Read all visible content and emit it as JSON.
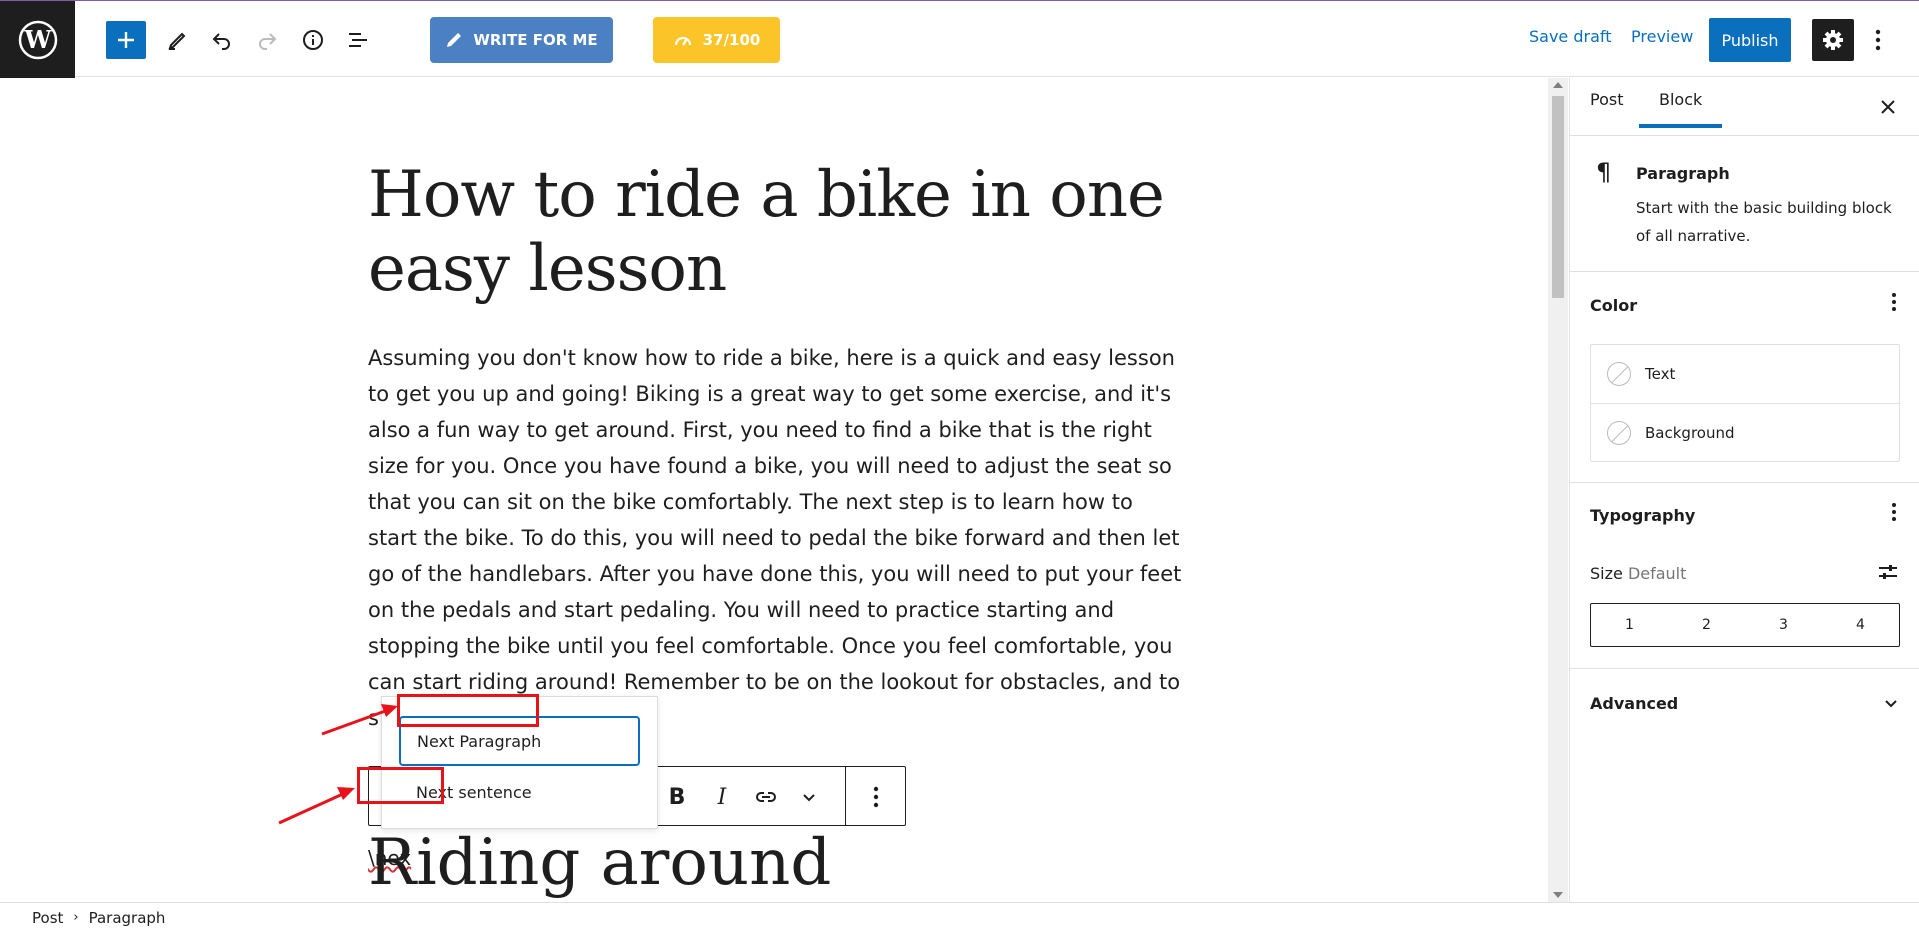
{
  "topbar": {
    "write_label": "WRITE FOR ME",
    "score_label": "37/100",
    "save_draft": "Save draft",
    "preview": "Preview",
    "publish": "Publish"
  },
  "editor": {
    "title": "How to ride a bike in one easy lesson",
    "paragraph": "Assuming you don't know how to ride a bike, here is a quick and easy lesson to get you up and going! Biking is a great way to get some exercise, and it's also a fun way to get around. First, you need to find a bike that is the right size for you. Once you have found a bike, you will need to adjust the seat so that you can sit on the bike comfortably. The next step is to learn how to start the bike. To do this, you will need to pedal the bike forward and then let go of the handlebars. After you have done this, you will need to put your feet on the pedals and start pedaling. You will need to practice starting and stopping the bike until you feel comfortable. Once you feel comfortable, you can start riding around! Remember to be on the lookout for obstacles, and to signal when you are",
    "slash_text": "\\nex",
    "heading2": "Riding around"
  },
  "popover": {
    "items": [
      "Next Paragraph",
      "Next sentence"
    ]
  },
  "sidebar": {
    "tabs": [
      "Post",
      "Block"
    ],
    "block_name": "Paragraph",
    "block_desc": "Start with the basic building block of all narrative.",
    "color_heading": "Color",
    "color_items": [
      "Text",
      "Background"
    ],
    "typography_heading": "Typography",
    "size_label": "Size",
    "size_value": "Default",
    "size_options": [
      "1",
      "2",
      "3",
      "4"
    ],
    "advanced_heading": "Advanced"
  },
  "breadcrumb": [
    "Post",
    "Paragraph"
  ],
  "colors": {
    "accent": "#0a6fbd",
    "write_btn": "#4b80c2",
    "score_btn": "#fbc52a",
    "annotation": "#e8121b"
  }
}
